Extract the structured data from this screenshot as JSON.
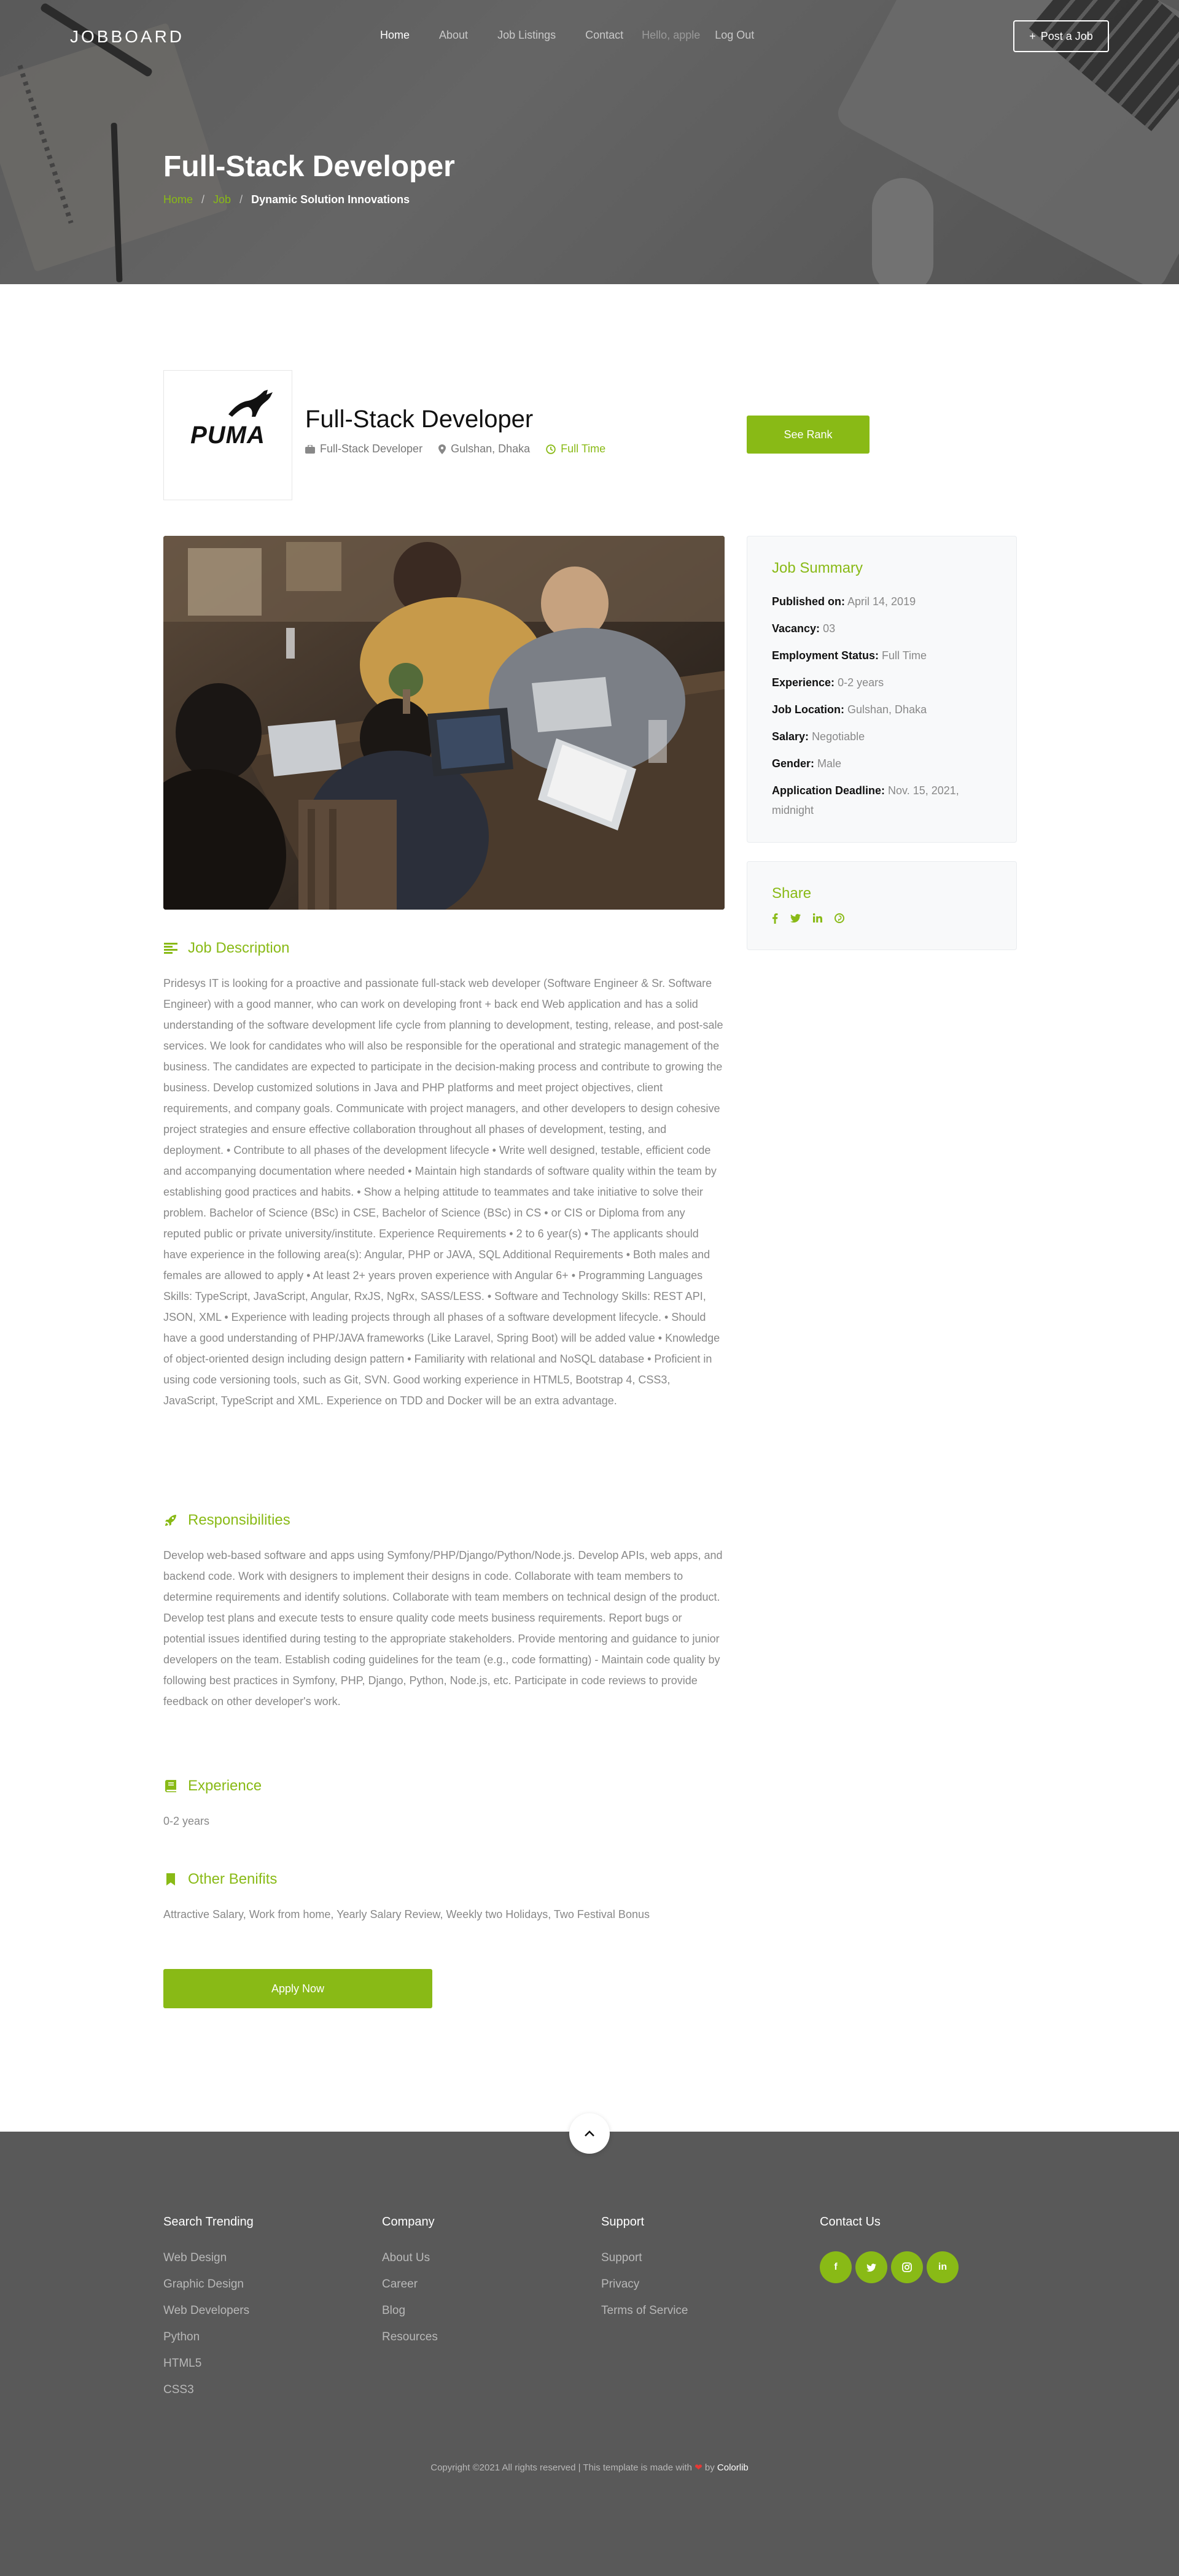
{
  "nav": {
    "logo": "JOBBOARD",
    "links": [
      "Home",
      "About",
      "Job Listings",
      "Contact"
    ],
    "muted_link": "Hello, apple",
    "logout": "Log Out",
    "post_job": "Post a Job"
  },
  "hero": {
    "title": "Full-Stack Developer",
    "breadcrumb": [
      "Home",
      "Job",
      "Dynamic Solution Innovations"
    ]
  },
  "job": {
    "company_logo_text": "PUMA",
    "title": "Full-Stack Developer",
    "category": "Full-Stack Developer",
    "location": "Gulshan, Dhaka",
    "type": "Full Time",
    "see_rank": "See Rank"
  },
  "summary": {
    "heading": "Job Summary",
    "rows": [
      {
        "label": "Published on:",
        "value": "April 14, 2019"
      },
      {
        "label": "Vacancy:",
        "value": "03"
      },
      {
        "label": "Employment Status:",
        "value": "Full Time"
      },
      {
        "label": "Experience:",
        "value": "0-2 years"
      },
      {
        "label": "Job Location:",
        "value": "Gulshan, Dhaka"
      },
      {
        "label": "Salary:",
        "value": "Negotiable"
      },
      {
        "label": "Gender:",
        "value": "Male"
      },
      {
        "label": "Application Deadline:",
        "value": "Nov. 15, 2021, midnight"
      }
    ]
  },
  "share": {
    "heading": "Share",
    "icons": [
      "facebook-icon",
      "twitter-icon",
      "linkedin-icon",
      "pinterest-icon"
    ]
  },
  "description": {
    "heading": "Job Description",
    "text": "Pridesys IT is looking for a proactive and passionate full-stack web developer (Software Engineer & Sr. Software Engineer) with a good manner, who can work on developing front + back end Web application and has a solid understanding of the software development life cycle from planning to development, testing, release, and post-sale services. We look for candidates who will also be responsible for the operational and strategic management of the business. The candidates are expected to participate in the decision-making process and contribute to growing the business. Develop customized solutions in Java and PHP platforms and meet project objectives, client requirements, and company goals. Communicate with project managers, and other developers to design cohesive project strategies and ensure effective collaboration throughout all phases of development, testing, and deployment. • Contribute to all phases of the development lifecycle • Write well designed, testable, efficient code and accompanying documentation where needed • Maintain high standards of software quality within the team by establishing good practices and habits. • Show a helping attitude to teammates and take initiative to solve their problem. Bachelor of Science (BSc) in CSE, Bachelor of Science (BSc) in CS • or CIS or Diploma from any reputed public or private university/institute. Experience Requirements • 2 to 6 year(s) • The applicants should have experience in the following area(s): Angular, PHP or JAVA, SQL Additional Requirements • Both males and females are allowed to apply • At least 2+ years proven experience with Angular 6+ • Programming Languages Skills: TypeScript, JavaScript, Angular, RxJS, NgRx, SASS/LESS. • Software and Technology Skills: REST API, JSON, XML • Experience with leading projects through all phases of a software development lifecycle. • Should have a good understanding of PHP/JAVA frameworks (Like Laravel, Spring Boot) will be added value • Knowledge of object-oriented design including design pattern • Familiarity with relational and NoSQL database • Proficient in using code versioning tools, such as Git, SVN. Good working experience in HTML5, Bootstrap 4, CSS3, JavaScript, TypeScript and XML. Experience on TDD and Docker will be an extra advantage."
  },
  "responsibilities": {
    "heading": "Responsibilities",
    "text": "Develop web-based software and apps using Symfony/PHP/Django/Python/Node.js. Develop APIs, web apps, and backend code. Work with designers to implement their designs in code. Collaborate with team members to determine requirements and identify solutions. Collaborate with team members on technical design of the product. Develop test plans and execute tests to ensure quality code meets business requirements. Report bugs or potential issues identified during testing to the appropriate stakeholders. Provide mentoring and guidance to junior developers on the team. Establish coding guidelines for the team (e.g., code formatting) - Maintain code quality by following best practices in Symfony, PHP, Django, Python, Node.js, etc. Participate in code reviews to provide feedback on other developer's work."
  },
  "experience": {
    "heading": "Experience",
    "text": "0-2 years"
  },
  "benefits": {
    "heading": "Other Benifits",
    "text": "Attractive Salary, Work from home, Yearly Salary Review, Weekly two Holidays, Two Festival Bonus"
  },
  "apply": "Apply Now",
  "footer": {
    "col1": {
      "heading": "Search Trending",
      "links": [
        "Web Design",
        "Graphic Design",
        "Web Developers",
        "Python",
        "HTML5",
        "CSS3"
      ]
    },
    "col2": {
      "heading": "Company",
      "links": [
        "About Us",
        "Career",
        "Blog",
        "Resources"
      ]
    },
    "col3": {
      "heading": "Support",
      "links": [
        "Support",
        "Privacy",
        "Terms of Service"
      ]
    },
    "col4": {
      "heading": "Contact Us"
    },
    "copyright": "Copyright ©2021 All rights reserved | This template is made with",
    "by": "by",
    "brand": "Colorlib"
  },
  "colors": {
    "accent": "#89ba16",
    "footer_bg": "#595959"
  }
}
